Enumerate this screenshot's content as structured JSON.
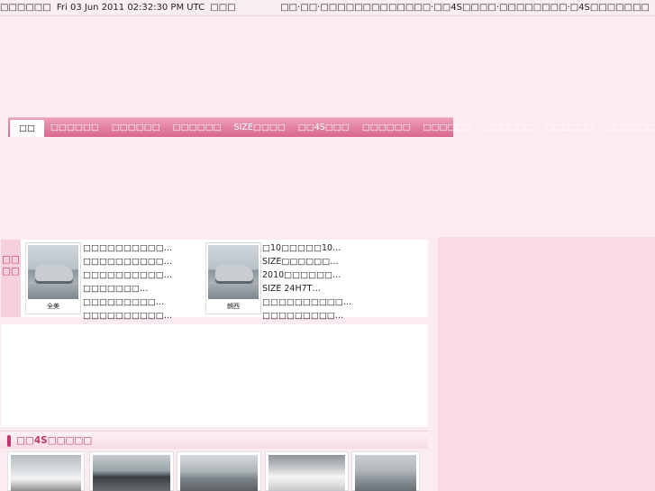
{
  "topbar": {
    "site_label": "□□□□□□",
    "datetime": "Fri 03 Jun 2011 02:32:30 PM UTC",
    "weather": "□□□",
    "links": "□□·□□·□□□□□□□□□□□□□·□□4S□□□□·□□□□□□□□·□4S□□□□□□□"
  },
  "nav": {
    "items": [
      {
        "label": "□□",
        "active": true
      },
      {
        "label": "□□□□□□"
      },
      {
        "label": "□□□□□□"
      },
      {
        "label": "□□□□□□"
      },
      {
        "label": "SIZE□□□□"
      },
      {
        "label": "□□4S□□□"
      },
      {
        "label": "□□□□□□"
      },
      {
        "label": "□□□□□□"
      },
      {
        "label": "□□□□□□"
      },
      {
        "label": "□□□□□□"
      },
      {
        "label": "□□□□□□"
      }
    ]
  },
  "news": {
    "tab_label": "□□ □□",
    "thumb1_caption": "全美",
    "thumb2_caption": "朗西",
    "list1": [
      "□□□□□□□□□□…",
      "□□□□□□□□□□…",
      "□□□□□□□□□□…",
      "□□□□□□□…",
      "□□□□□□□□□…",
      "□□□□□□□□□□…"
    ],
    "list2": [
      "□10□□□□□10…",
      "SIZE□□□□□□…",
      "2010□□□□□□…",
      "SIZE 24H7T…",
      "□□□□□□□□□□…",
      "□□□□□□□□□…"
    ]
  },
  "section": {
    "title": "□□4S□□□□□"
  }
}
